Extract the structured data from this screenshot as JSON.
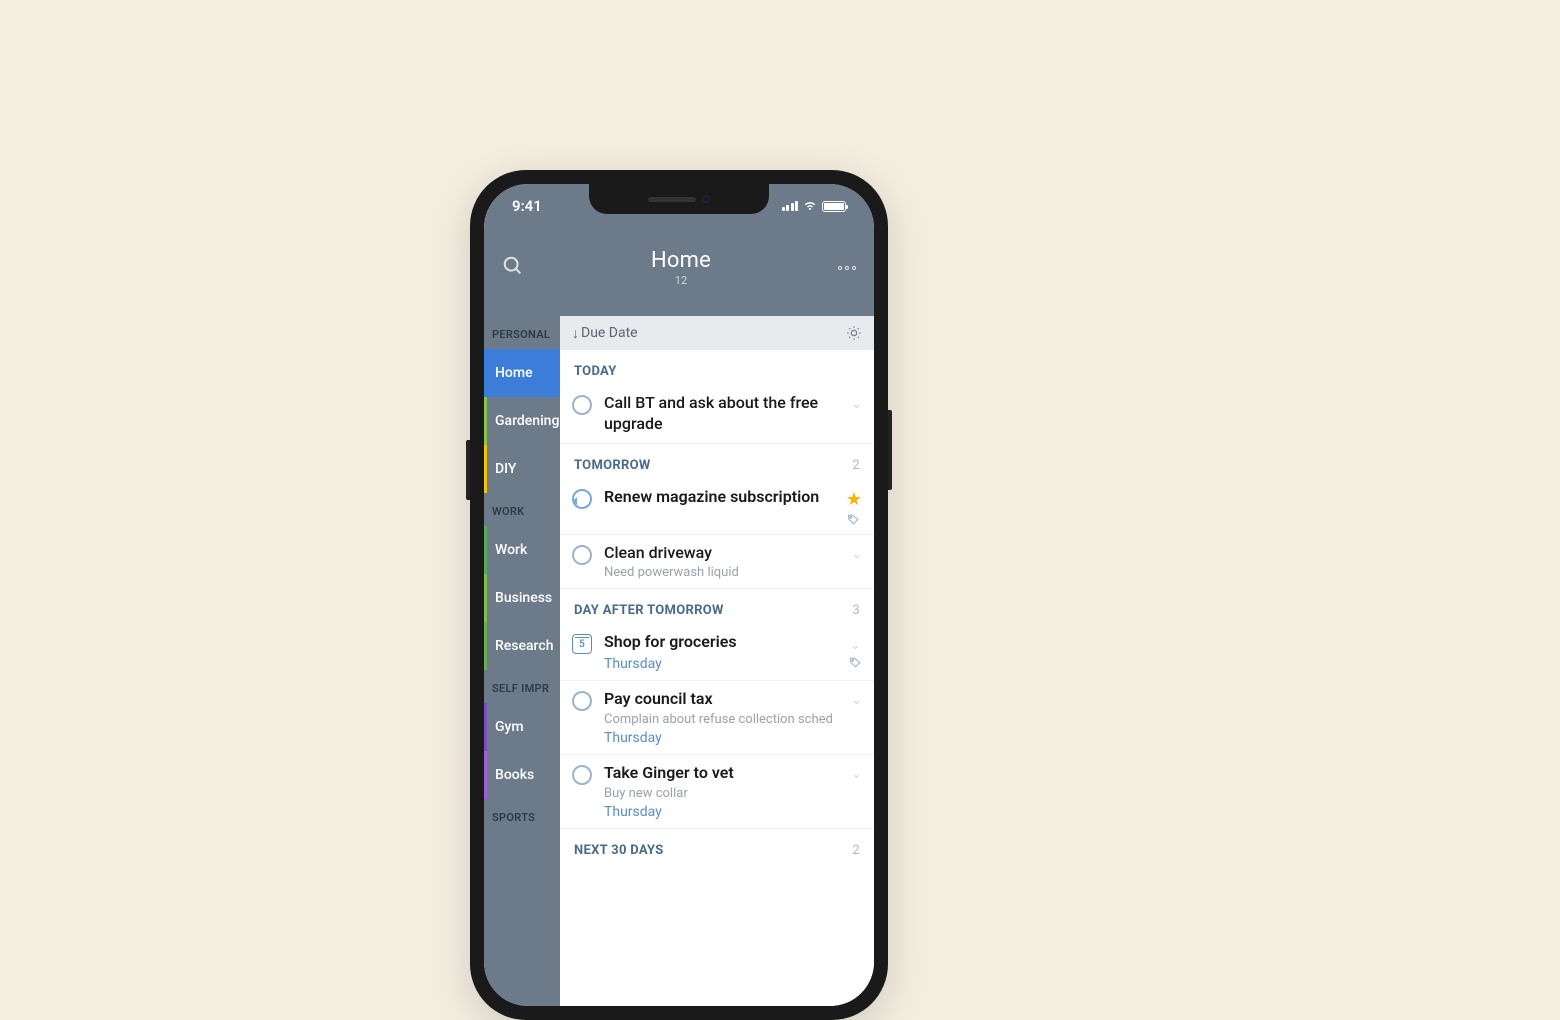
{
  "status": {
    "time": "9:41"
  },
  "header": {
    "title": "Home",
    "count": "12"
  },
  "sort": {
    "label": "Due Date"
  },
  "sidebar": {
    "sections": [
      {
        "title": "PERSONAL",
        "items": [
          {
            "label": "Home",
            "color": "#3b7dd8",
            "active": true
          },
          {
            "label": "Gardening",
            "color": "#8bc34a"
          },
          {
            "label": "DIY",
            "color": "#f5c400"
          }
        ]
      },
      {
        "title": "WORK",
        "items": [
          {
            "label": "Work",
            "color": "#5aa85a"
          },
          {
            "label": "Business",
            "color": "#7bbf4a"
          },
          {
            "label": "Research",
            "color": "#6aad52"
          }
        ]
      },
      {
        "title": "SELF IMPR",
        "items": [
          {
            "label": "Gym",
            "color": "#7a4fbf"
          },
          {
            "label": "Books",
            "color": "#9a5fd0"
          }
        ]
      },
      {
        "title": "SPORTS",
        "items": []
      }
    ]
  },
  "sections": [
    {
      "title": "TODAY",
      "count": "",
      "tasks": [
        {
          "title": "Call BT and ask about the free upgrade",
          "checkType": "circle"
        }
      ]
    },
    {
      "title": "TOMORROW",
      "count": "2",
      "tasks": [
        {
          "title": "Renew magazine subscription",
          "checkType": "repeat",
          "bold": true,
          "star": true,
          "tag": true
        },
        {
          "title": "Clean driveway",
          "note": "Need powerwash liquid",
          "checkType": "circle"
        }
      ]
    },
    {
      "title": "DAY AFTER TOMORROW",
      "count": "3",
      "tasks": [
        {
          "title": "Shop for groceries",
          "due": "Thursday",
          "checkType": "date",
          "dateNum": "5",
          "bold": true,
          "tag": true
        },
        {
          "title": "Pay council tax",
          "note": "Complain about refuse collection sched",
          "due": "Thursday",
          "checkType": "circle",
          "bold": true
        },
        {
          "title": "Take Ginger to vet",
          "note": "Buy new collar",
          "due": "Thursday",
          "checkType": "circle",
          "bold": true
        }
      ]
    },
    {
      "title": "NEXT 30 DAYS",
      "count": "2",
      "tasks": []
    }
  ]
}
